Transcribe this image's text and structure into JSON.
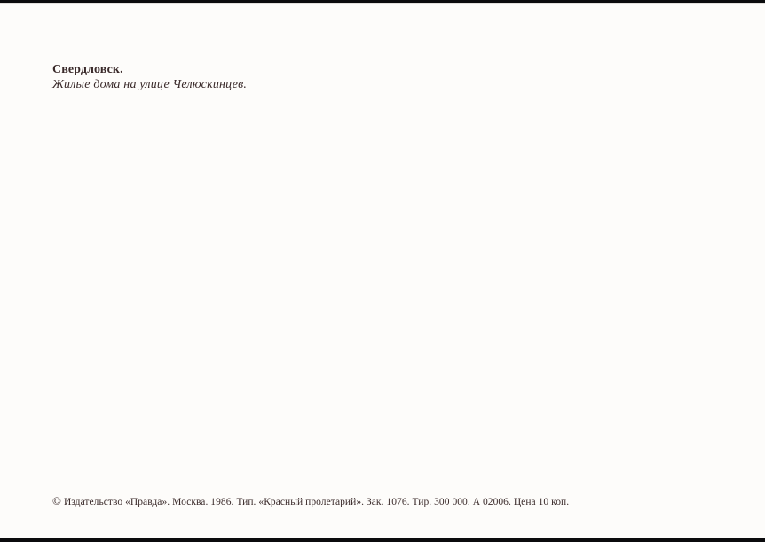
{
  "caption": {
    "city": "Свердловск.",
    "subtitle": "Жилые дома на улице Челюскинцев."
  },
  "imprint": {
    "copyright_symbol": "©",
    "text": "Издательство «Правда». Москва. 1986. Тип. «Красный пролетарий». Зак. 1076. Тир. 300 000. А 02006. Цена 10 коп."
  }
}
